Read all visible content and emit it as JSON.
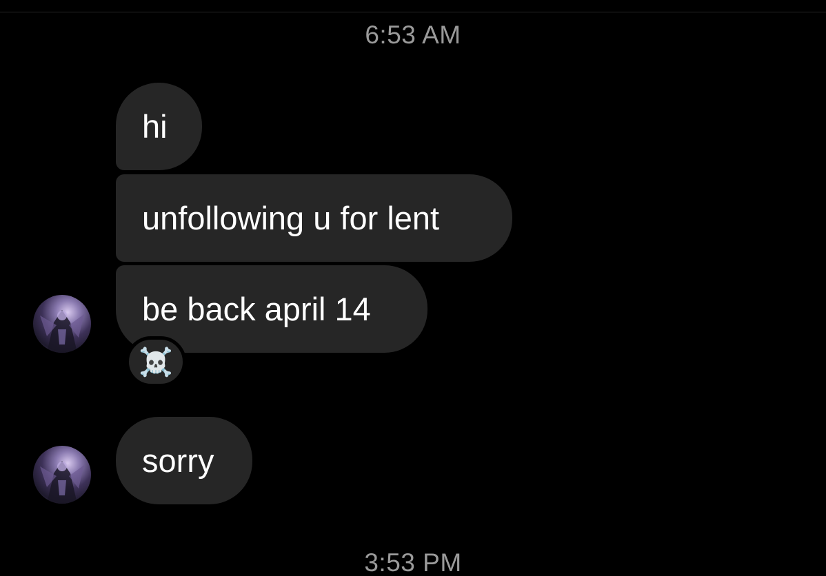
{
  "thread": {
    "timestamp_top": "6:53 AM",
    "timestamp_bottom": "3:53 PM",
    "messages": [
      {
        "text": "hi"
      },
      {
        "text": "unfollowing u for lent"
      },
      {
        "text": "be back april 14",
        "reaction": "☠️"
      },
      {
        "text": "sorry"
      }
    ]
  },
  "colors": {
    "background": "#000000",
    "bubble": "#262626",
    "text": "#ffffff",
    "timestamp": "#9a9a9a"
  },
  "icons": {
    "avatar": "profile-avatar-image",
    "reaction": "skull-and-crossbones"
  }
}
